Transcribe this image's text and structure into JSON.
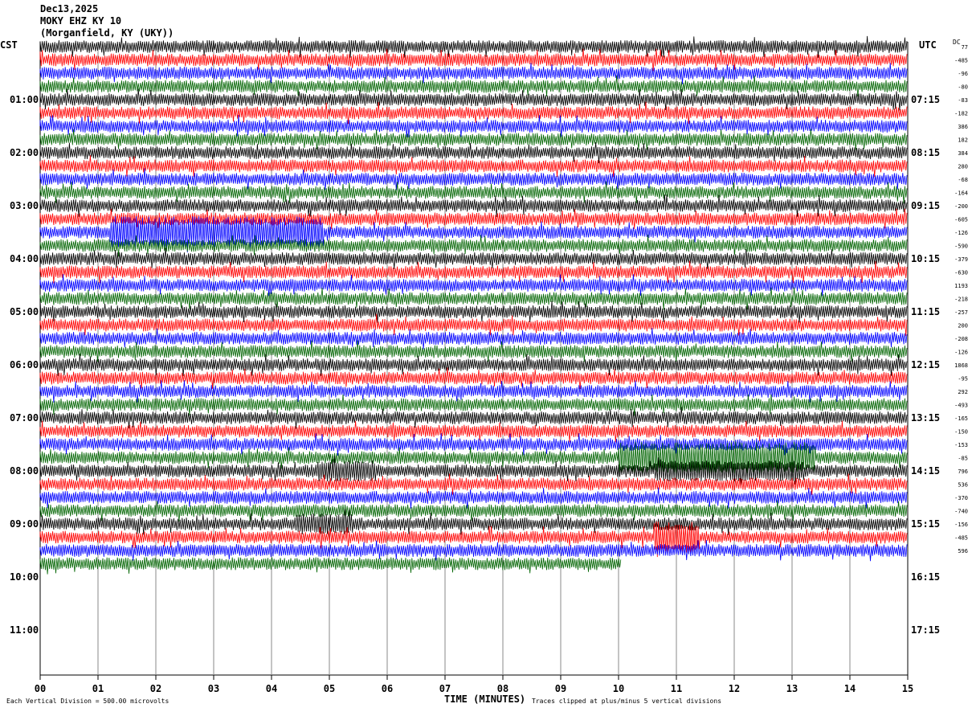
{
  "header": {
    "date": "Dec13,2025",
    "station": "MOKY EHZ KY 10",
    "location": "(Morganfield, KY (UKY))"
  },
  "left_axis_label": "CST",
  "right_axis_label": "UTC",
  "dc_label": "DC",
  "footer": {
    "xlabel": "TIME (MINUTES)",
    "scale_note": "Each Vertical Division =  500.00 microvolts",
    "clip_note": "Traces clipped at plus/minus 5 vertical divisions"
  },
  "colors": {
    "trace_cycle": [
      "#000000",
      "#ff0000",
      "#0000ff",
      "#006400"
    ],
    "grid": "#000000"
  },
  "chart_data": {
    "type": "line",
    "title": "MOKY EHZ KY 10",
    "xlabel": "TIME (MINUTES)",
    "ylabel": "",
    "xlim": [
      0,
      15
    ],
    "x_ticks": [
      "00",
      "01",
      "02",
      "03",
      "04",
      "05",
      "06",
      "07",
      "08",
      "09",
      "10",
      "11",
      "12",
      "13",
      "14",
      "15"
    ],
    "left_hour_ticks": [
      "01:00",
      "02:00",
      "03:00",
      "04:00",
      "05:00",
      "06:00",
      "07:00",
      "08:00",
      "09:00",
      "10:00",
      "11:00"
    ],
    "right_hour_ticks": [
      "07:15",
      "08:15",
      "09:15",
      "10:15",
      "11:15",
      "12:15",
      "13:15",
      "14:15",
      "15:15",
      "16:15",
      "17:15"
    ],
    "traces_per_hour": 4,
    "total_lines": 48,
    "filled_lines": 40,
    "last_line_end_minute": 10.05,
    "dc_offsets": [
      "77",
      "-485",
      "-96",
      "-80",
      "-83",
      "-182",
      "386",
      "182",
      "384",
      "280",
      "-68",
      "-164",
      "-200",
      "-605",
      "-126",
      "-590",
      "-379",
      "-630",
      "1193",
      "-218",
      "-257",
      "200",
      "-208",
      "-126",
      "1868",
      "-95",
      "292",
      "-493",
      "-165",
      "-150",
      "-153",
      "-85",
      "796",
      "536",
      "-370",
      "-740",
      "-156",
      "-485",
      "596"
    ],
    "events": [
      {
        "line": 14,
        "start_min": 1.2,
        "end_min": 4.9,
        "amplitude": "high"
      },
      {
        "line": 31,
        "start_min": 10.0,
        "end_min": 13.4,
        "amplitude": "high"
      },
      {
        "line": 32,
        "start_min": 4.8,
        "end_min": 5.8,
        "amplitude": "medium"
      },
      {
        "line": 32,
        "start_min": 10.6,
        "end_min": 13.2,
        "amplitude": "medium"
      },
      {
        "line": 36,
        "start_min": 4.4,
        "end_min": 5.4,
        "amplitude": "medium"
      },
      {
        "line": 37,
        "start_min": 10.6,
        "end_min": 11.4,
        "amplitude": "high"
      }
    ],
    "grid": true
  }
}
